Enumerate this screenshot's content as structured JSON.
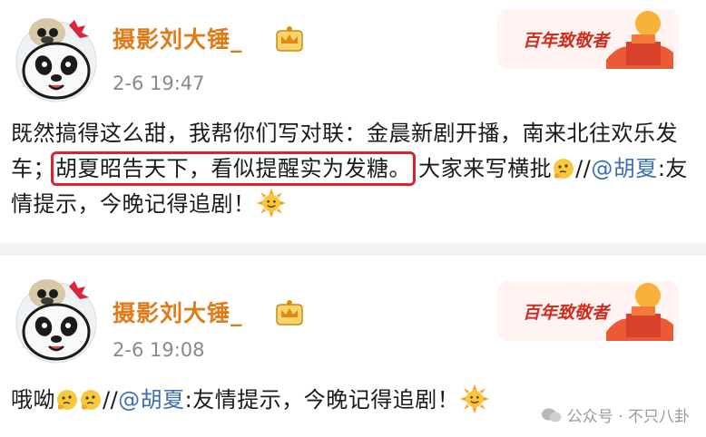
{
  "posts": [
    {
      "username": "摄影刘大锤_",
      "time": "2-6 19:47",
      "badge_text": "百年致敬者",
      "content": {
        "part1": "既然搞得这么甜，我帮你们写对联：金晨新剧开播，南来北往欢乐发车；",
        "highlight": "胡夏昭告天下，看似提醒实为发糖。",
        "part2": "大家来写横批",
        "sep": "//",
        "mention": "@胡夏",
        "part3": ":友情提示，今晚记得追剧！"
      }
    },
    {
      "username": "摄影刘大锤_",
      "time": "2-6 19:08",
      "badge_text": "百年致敬者",
      "content": {
        "part1": "哦呦",
        "sep": "//",
        "mention": "@胡夏",
        "part3": ":友情提示，今晚记得追剧！"
      }
    }
  ],
  "watermark": "公众号 · 不只八卦",
  "icons": {
    "avatar": "panda-pug-avatar-icon",
    "vip": "crown-icon",
    "badge": "centennial-badge-icon",
    "emoji_think": "thinking-emoji-icon",
    "emoji_sun": "sun-emoji-icon",
    "wechat": "wechat-icon"
  },
  "colors": {
    "username": "#e07b18",
    "mention": "#3e6fb5",
    "highlight_border": "#d9232e"
  }
}
